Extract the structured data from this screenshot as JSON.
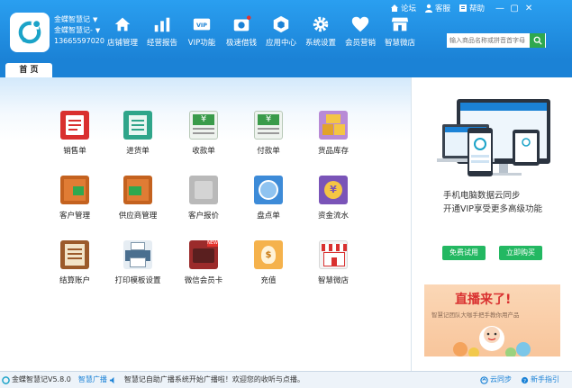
{
  "header": {
    "store_name_1": "金蝶智慧记",
    "store_name_2": "金蝶智慧记-",
    "phone": "13665597020",
    "search_placeholder": "输入商品名称或拼音首字母",
    "top_links": {
      "forum": "论坛",
      "service": "客服",
      "help": "帮助"
    },
    "nav": [
      {
        "label": "店铺管理",
        "icon": "home-icon"
      },
      {
        "label": "经营报告",
        "icon": "bar-chart-icon"
      },
      {
        "label": "VIP功能",
        "icon": "vip-card-icon"
      },
      {
        "label": "极速借钱",
        "icon": "money-bag-icon"
      },
      {
        "label": "应用中心",
        "icon": "app-cube-icon"
      },
      {
        "label": "系统设置",
        "icon": "gear-icon"
      },
      {
        "label": "会员营销",
        "icon": "heart-icon"
      },
      {
        "label": "智慧微店",
        "icon": "shop-icon"
      }
    ]
  },
  "tabs": {
    "home": "首 页"
  },
  "tiles": [
    {
      "label": "销售单",
      "icon": "sales-order-icon",
      "color": "#d9302f"
    },
    {
      "label": "进货单",
      "icon": "purchase-order-icon",
      "color": "#2fa58a"
    },
    {
      "label": "收款单",
      "icon": "receipt-icon",
      "color": "#3a9b4a"
    },
    {
      "label": "付款单",
      "icon": "payment-icon",
      "color": "#3a9b4a"
    },
    {
      "label": "货品库存",
      "icon": "inventory-icon",
      "color": "#e2a32b"
    },
    {
      "label": "客户管理",
      "icon": "customer-icon",
      "color": "#c4621f"
    },
    {
      "label": "供应商管理",
      "icon": "supplier-icon",
      "color": "#c4621f"
    },
    {
      "label": "客户报价",
      "icon": "quote-icon",
      "color": "#9a9a9a"
    },
    {
      "label": "盘点单",
      "icon": "stocktake-icon",
      "color": "#3d8bd8"
    },
    {
      "label": "资金流水",
      "icon": "cash-flow-icon",
      "color": "#7a54b8"
    },
    {
      "label": "结算账户",
      "icon": "account-icon",
      "color": "#9b5a2a"
    },
    {
      "label": "打印模板设置",
      "icon": "printer-icon",
      "color": "#4a6f8f"
    },
    {
      "label": "微信会员卡",
      "icon": "wechat-card-icon",
      "color": "#9b2b2b"
    },
    {
      "label": "充值",
      "icon": "recharge-icon",
      "color": "#f2a43a"
    },
    {
      "label": "智慧微店",
      "icon": "micro-shop-icon",
      "color": "#d9302f"
    }
  ],
  "promo": {
    "line1": "手机电脑数据云同步",
    "line2": "开通VIP享受更多高级功能",
    "btn_trial": "免费试用",
    "btn_open": "立即购买",
    "banner_title": "直播来了!",
    "banner_sub": "智慧记团队大咖手把手教你用产品"
  },
  "status": {
    "version": "金蝶智慧记V5.8.0",
    "broadcast_label": "智慧广播",
    "message": "智慧记自助广播系统开始广播啦！欢迎您的收听与点播。",
    "cloud_sync": "云同步",
    "novice": "新手指引"
  },
  "colors": {
    "header": "#1b82d6",
    "accent_green": "#23b862"
  }
}
